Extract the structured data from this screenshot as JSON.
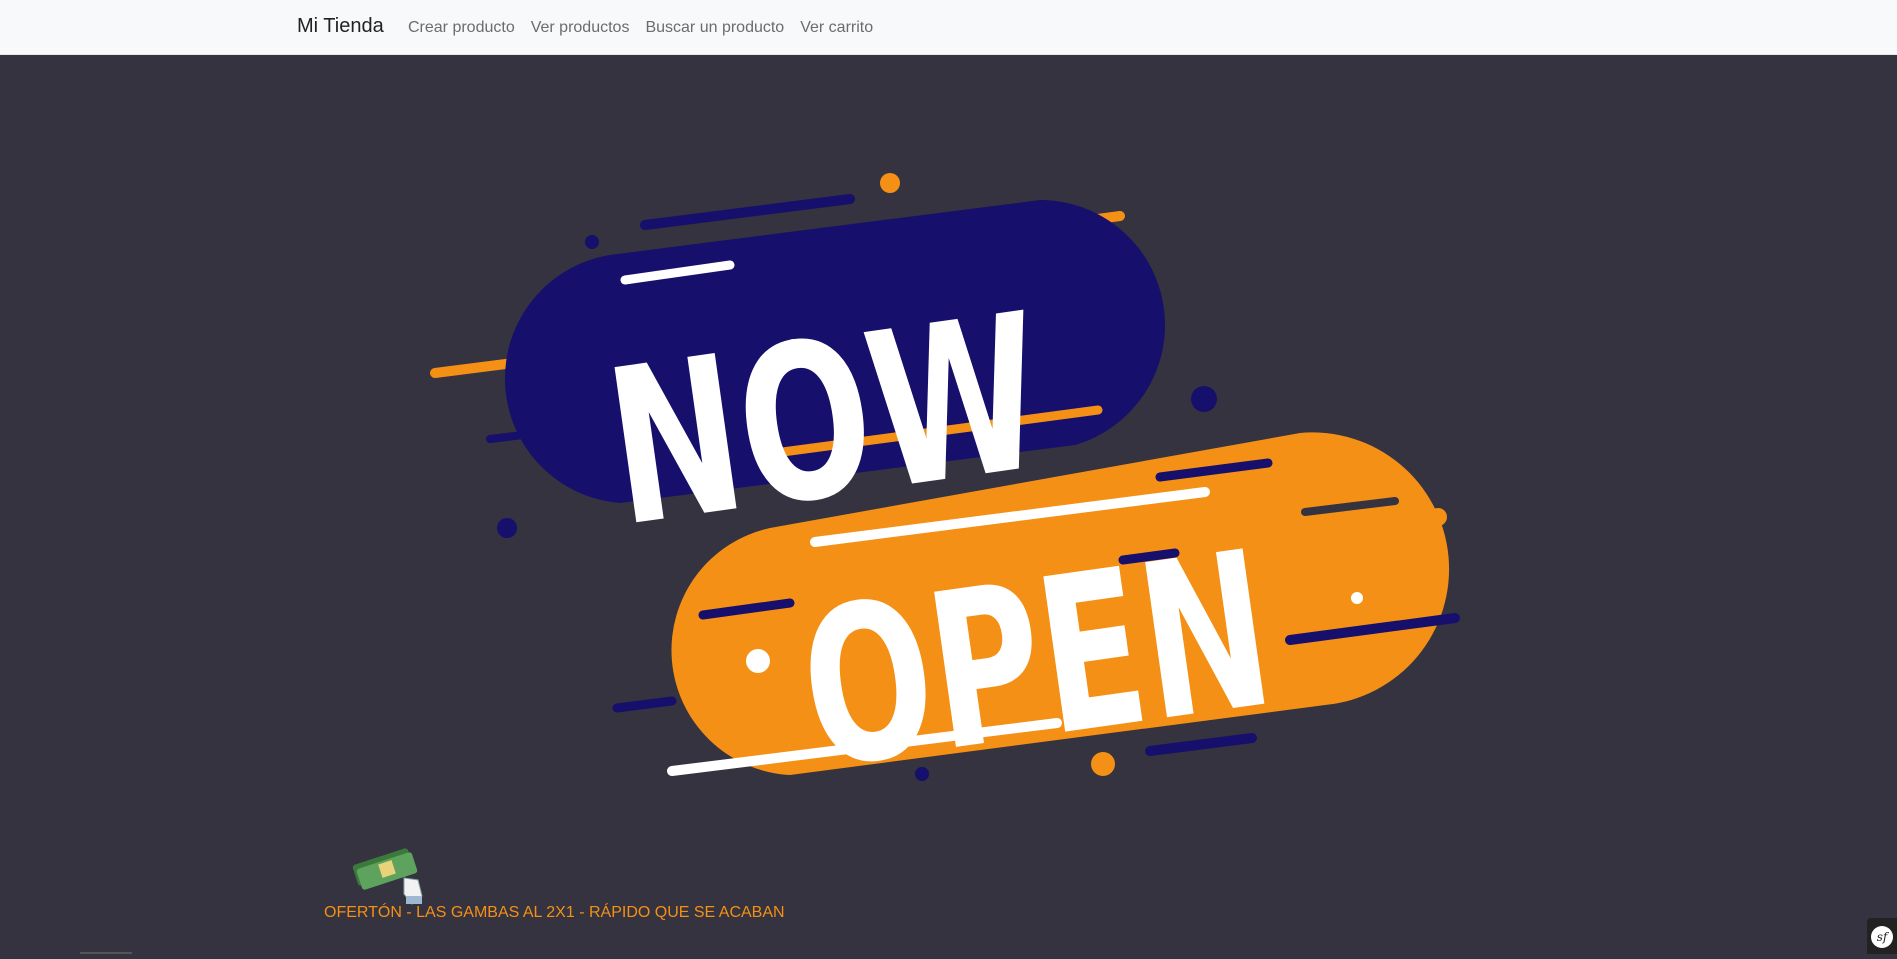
{
  "navbar": {
    "brand": "Mi Tienda",
    "links": [
      {
        "label": "Crear producto"
      },
      {
        "label": "Ver productos"
      },
      {
        "label": "Buscar un producto"
      },
      {
        "label": "Ver carrito"
      }
    ]
  },
  "hero": {
    "line1": "NOW",
    "line2": "OPEN",
    "colors": {
      "background": "#34333f",
      "navy": "#160f6b",
      "orange": "#f59016",
      "white": "#ffffff",
      "shade": "#c9c9c9"
    }
  },
  "promo": {
    "text": "OFERTÓN - LAS GAMBAS AL 2X1 - RÁPIDO QUE SE ACABAN",
    "icon": "money-hand-icon"
  },
  "debug_toolbar": {
    "logo": "sf"
  }
}
